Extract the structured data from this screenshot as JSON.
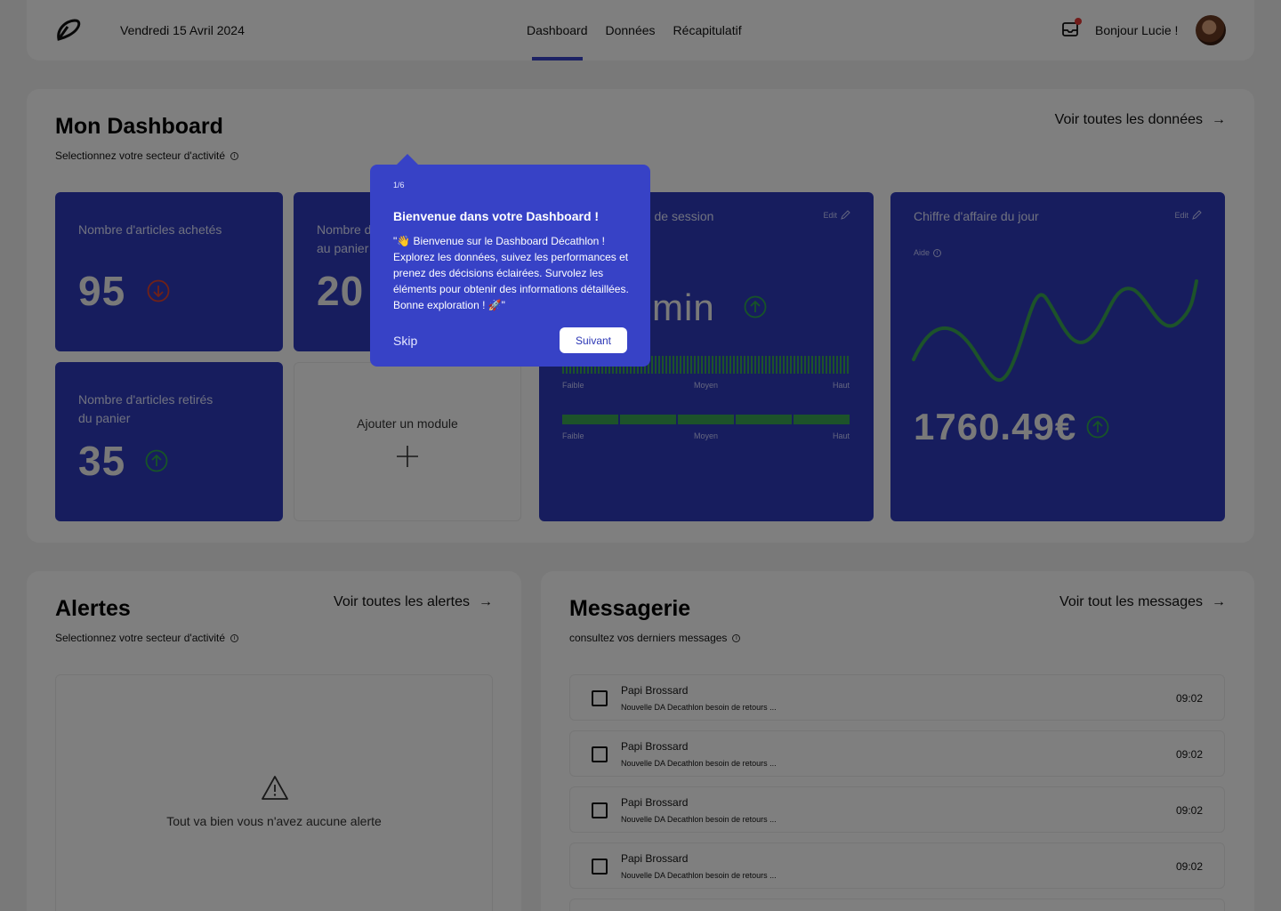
{
  "header": {
    "date": "Vendredi 15 Avril 2024",
    "nav": [
      {
        "label": "Dashboard",
        "active": true
      },
      {
        "label": "Données",
        "active": false
      },
      {
        "label": "Récapitulatif",
        "active": false
      }
    ],
    "greeting": "Bonjour Lucie !",
    "notification_badge_color": "#e53935"
  },
  "dashboard": {
    "title": "Mon Dashboard",
    "subtitle": "Selectionnez votre secteur d'activité",
    "see_all": "Voir toutes les données",
    "cards": {
      "articles_achetes": {
        "label": "Nombre d'articles achetés",
        "value": "95",
        "trend": "down",
        "trend_color": "#e0432f"
      },
      "articles_ajoutes": {
        "label": "Nombre d'articles ajoutés au panier",
        "value": "20"
      },
      "articles_retires": {
        "label": "Nombre d'articles retirés du panier",
        "value": "35",
        "trend": "up",
        "trend_color": "#2fa84f"
      },
      "add_module": {
        "label": "Ajouter un module"
      },
      "session": {
        "title": "Durée moyenne de session",
        "value": "3 min",
        "edit": "Edit",
        "trend": "up",
        "scale_labels": [
          "Faible",
          "Moyen",
          "Haut"
        ]
      },
      "chiffre_affaire": {
        "title": "Chiffre d'affaire du jour",
        "edit": "Edit",
        "aide": "Aide",
        "value": "1760.49€",
        "trend": "up",
        "line_color": "#3aa655"
      }
    }
  },
  "alerts": {
    "title": "Alertes",
    "subtitle": "Selectionnez votre secteur d'activité",
    "see_all": "Voir toutes les alertes",
    "empty_text": "Tout va bien vous n'avez aucune alerte"
  },
  "messages": {
    "title": "Messagerie",
    "subtitle": "consultez vos derniers messages",
    "see_all": "Voir tout les messages",
    "items": [
      {
        "sender": "Papi Brossard",
        "preview": "Nouvelle DA Decathlon besoin de retours ...",
        "time": "09:02"
      },
      {
        "sender": "Papi Brossard",
        "preview": "Nouvelle DA Decathlon besoin de retours ...",
        "time": "09:02"
      },
      {
        "sender": "Papi Brossard",
        "preview": "Nouvelle DA Decathlon besoin de retours ...",
        "time": "09:02"
      },
      {
        "sender": "Papi Brossard",
        "preview": "Nouvelle DA Decathlon besoin de retours ...",
        "time": "09:02"
      }
    ]
  },
  "tour": {
    "step": "1/6",
    "title": "Bienvenue dans votre Dashboard !",
    "body": "\"👋 Bienvenue sur le Dashboard Décathlon ! Explorez les données, suivez  les performances et prenez des décisions éclairées. Survolez les éléments pour obtenir des informations détaillées. Bonne exploration ! 🚀\"",
    "skip": "Skip",
    "next": "Suivant"
  },
  "colors": {
    "card_blue": "#2f3bbd",
    "tour_blue": "#3742c6",
    "accent_green": "#2fa84f",
    "accent_red": "#e0432f"
  }
}
